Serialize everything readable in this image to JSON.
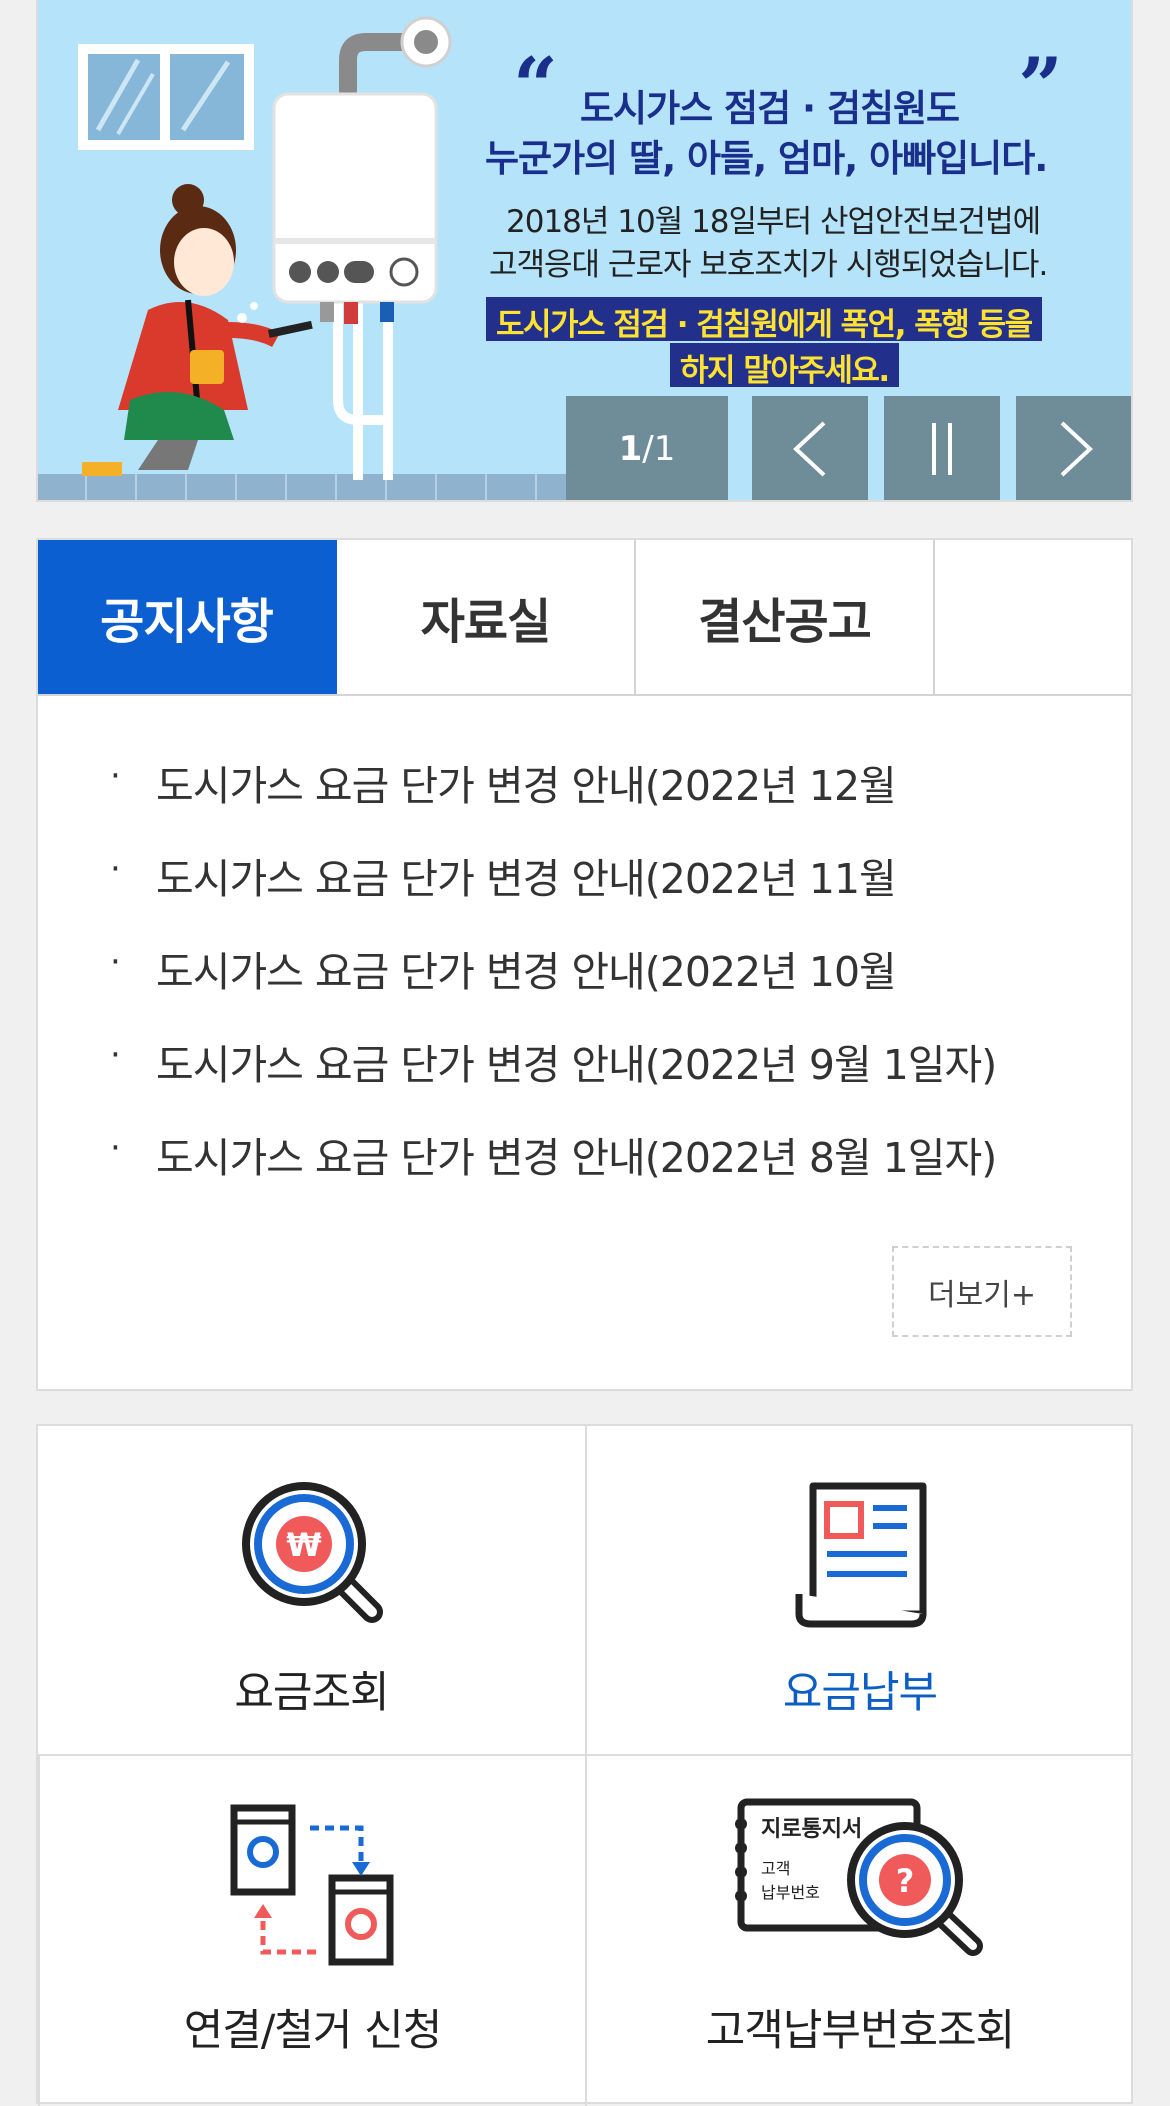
{
  "banner": {
    "quote_open": "“",
    "quote_close": "”",
    "title_line1": "도시가스 점검 · 검침원도",
    "title_line2": "누군가의 딸, 아들, 엄마, 아빠입니다.",
    "body_line1": "2018년 10월 18일부터 산업안전보건법에",
    "body_line2": "고객응대 근로자 보호조치가 시행되었습니다.",
    "highlight_line1": "도시가스 점검 · 검침원에게 폭언, 폭행 등을",
    "highlight_line2": "하지 말아주세요.",
    "slide_current": "1",
    "slide_separator": "/",
    "slide_total": "1",
    "prev_icon": "chevron-left-icon",
    "pause_icon": "pause-icon",
    "next_icon": "chevron-right-icon"
  },
  "tabs": [
    {
      "label": "공지사항",
      "active": true
    },
    {
      "label": "자료실",
      "active": false
    },
    {
      "label": "결산공고",
      "active": false
    }
  ],
  "notices": {
    "bullet": "·",
    "items": [
      "도시가스 요금 단가 변경 안내(2022년 12월",
      "도시가스 요금 단가 변경 안내(2022년 11월",
      "도시가스 요금 단가 변경 안내(2022년 10월",
      "도시가스 요금 단가 변경 안내(2022년 9월 1일자)",
      "도시가스 요금 단가 변경 안내(2022년 8월 1일자)"
    ],
    "more_label": "더보기+"
  },
  "quick_menu": [
    {
      "label": "요금조회",
      "icon": "won-magnifier-icon"
    },
    {
      "label": "요금납부",
      "icon": "bill-document-icon"
    },
    {
      "label": "연결/철거 신청",
      "icon": "connect-disconnect-icon"
    },
    {
      "label": "고객납부번호조회",
      "icon": "giro-notice-search-icon",
      "icon_text": [
        "지로통지서",
        "고객",
        "납부번호"
      ],
      "icon_symbol": "?"
    }
  ],
  "colors": {
    "tab_active": "#0b5fd0",
    "banner_bg": "#b5e4fa",
    "banner_title": "#1a2e8c",
    "highlight_bg": "#22308c",
    "highlight_text": "#ffe330",
    "control_bg": "#6f8c99",
    "quick_active_label": "#0b5fc4"
  }
}
